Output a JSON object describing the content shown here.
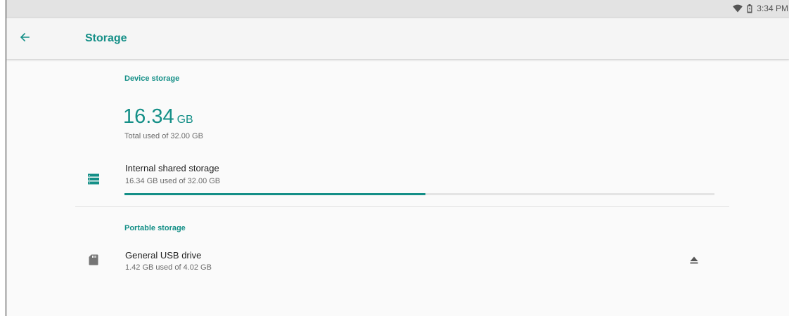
{
  "status_bar": {
    "time": "3:34 PM",
    "icons": [
      "wifi-icon",
      "battery-icon"
    ]
  },
  "toolbar": {
    "back_icon": "arrow-back-icon",
    "title": "Storage"
  },
  "device_storage": {
    "header": "Device storage",
    "used_value": "16.34",
    "used_unit": "GB",
    "total_text": "Total used of 32.00 GB",
    "items": [
      {
        "icon": "storage-list-icon",
        "title": "Internal shared storage",
        "subtitle": "16.34 GB used of 32.00 GB",
        "used_fraction": 0.51
      }
    ]
  },
  "portable_storage": {
    "header": "Portable storage",
    "items": [
      {
        "icon": "sd-card-icon",
        "title": "General USB drive",
        "subtitle": "1.42 GB used of 4.02 GB",
        "action_icon": "eject-icon"
      }
    ]
  },
  "colors": {
    "accent": "#148f87",
    "background": "#fafafa",
    "status_bar": "#e3e3e3",
    "toolbar": "#f5f5f5"
  }
}
